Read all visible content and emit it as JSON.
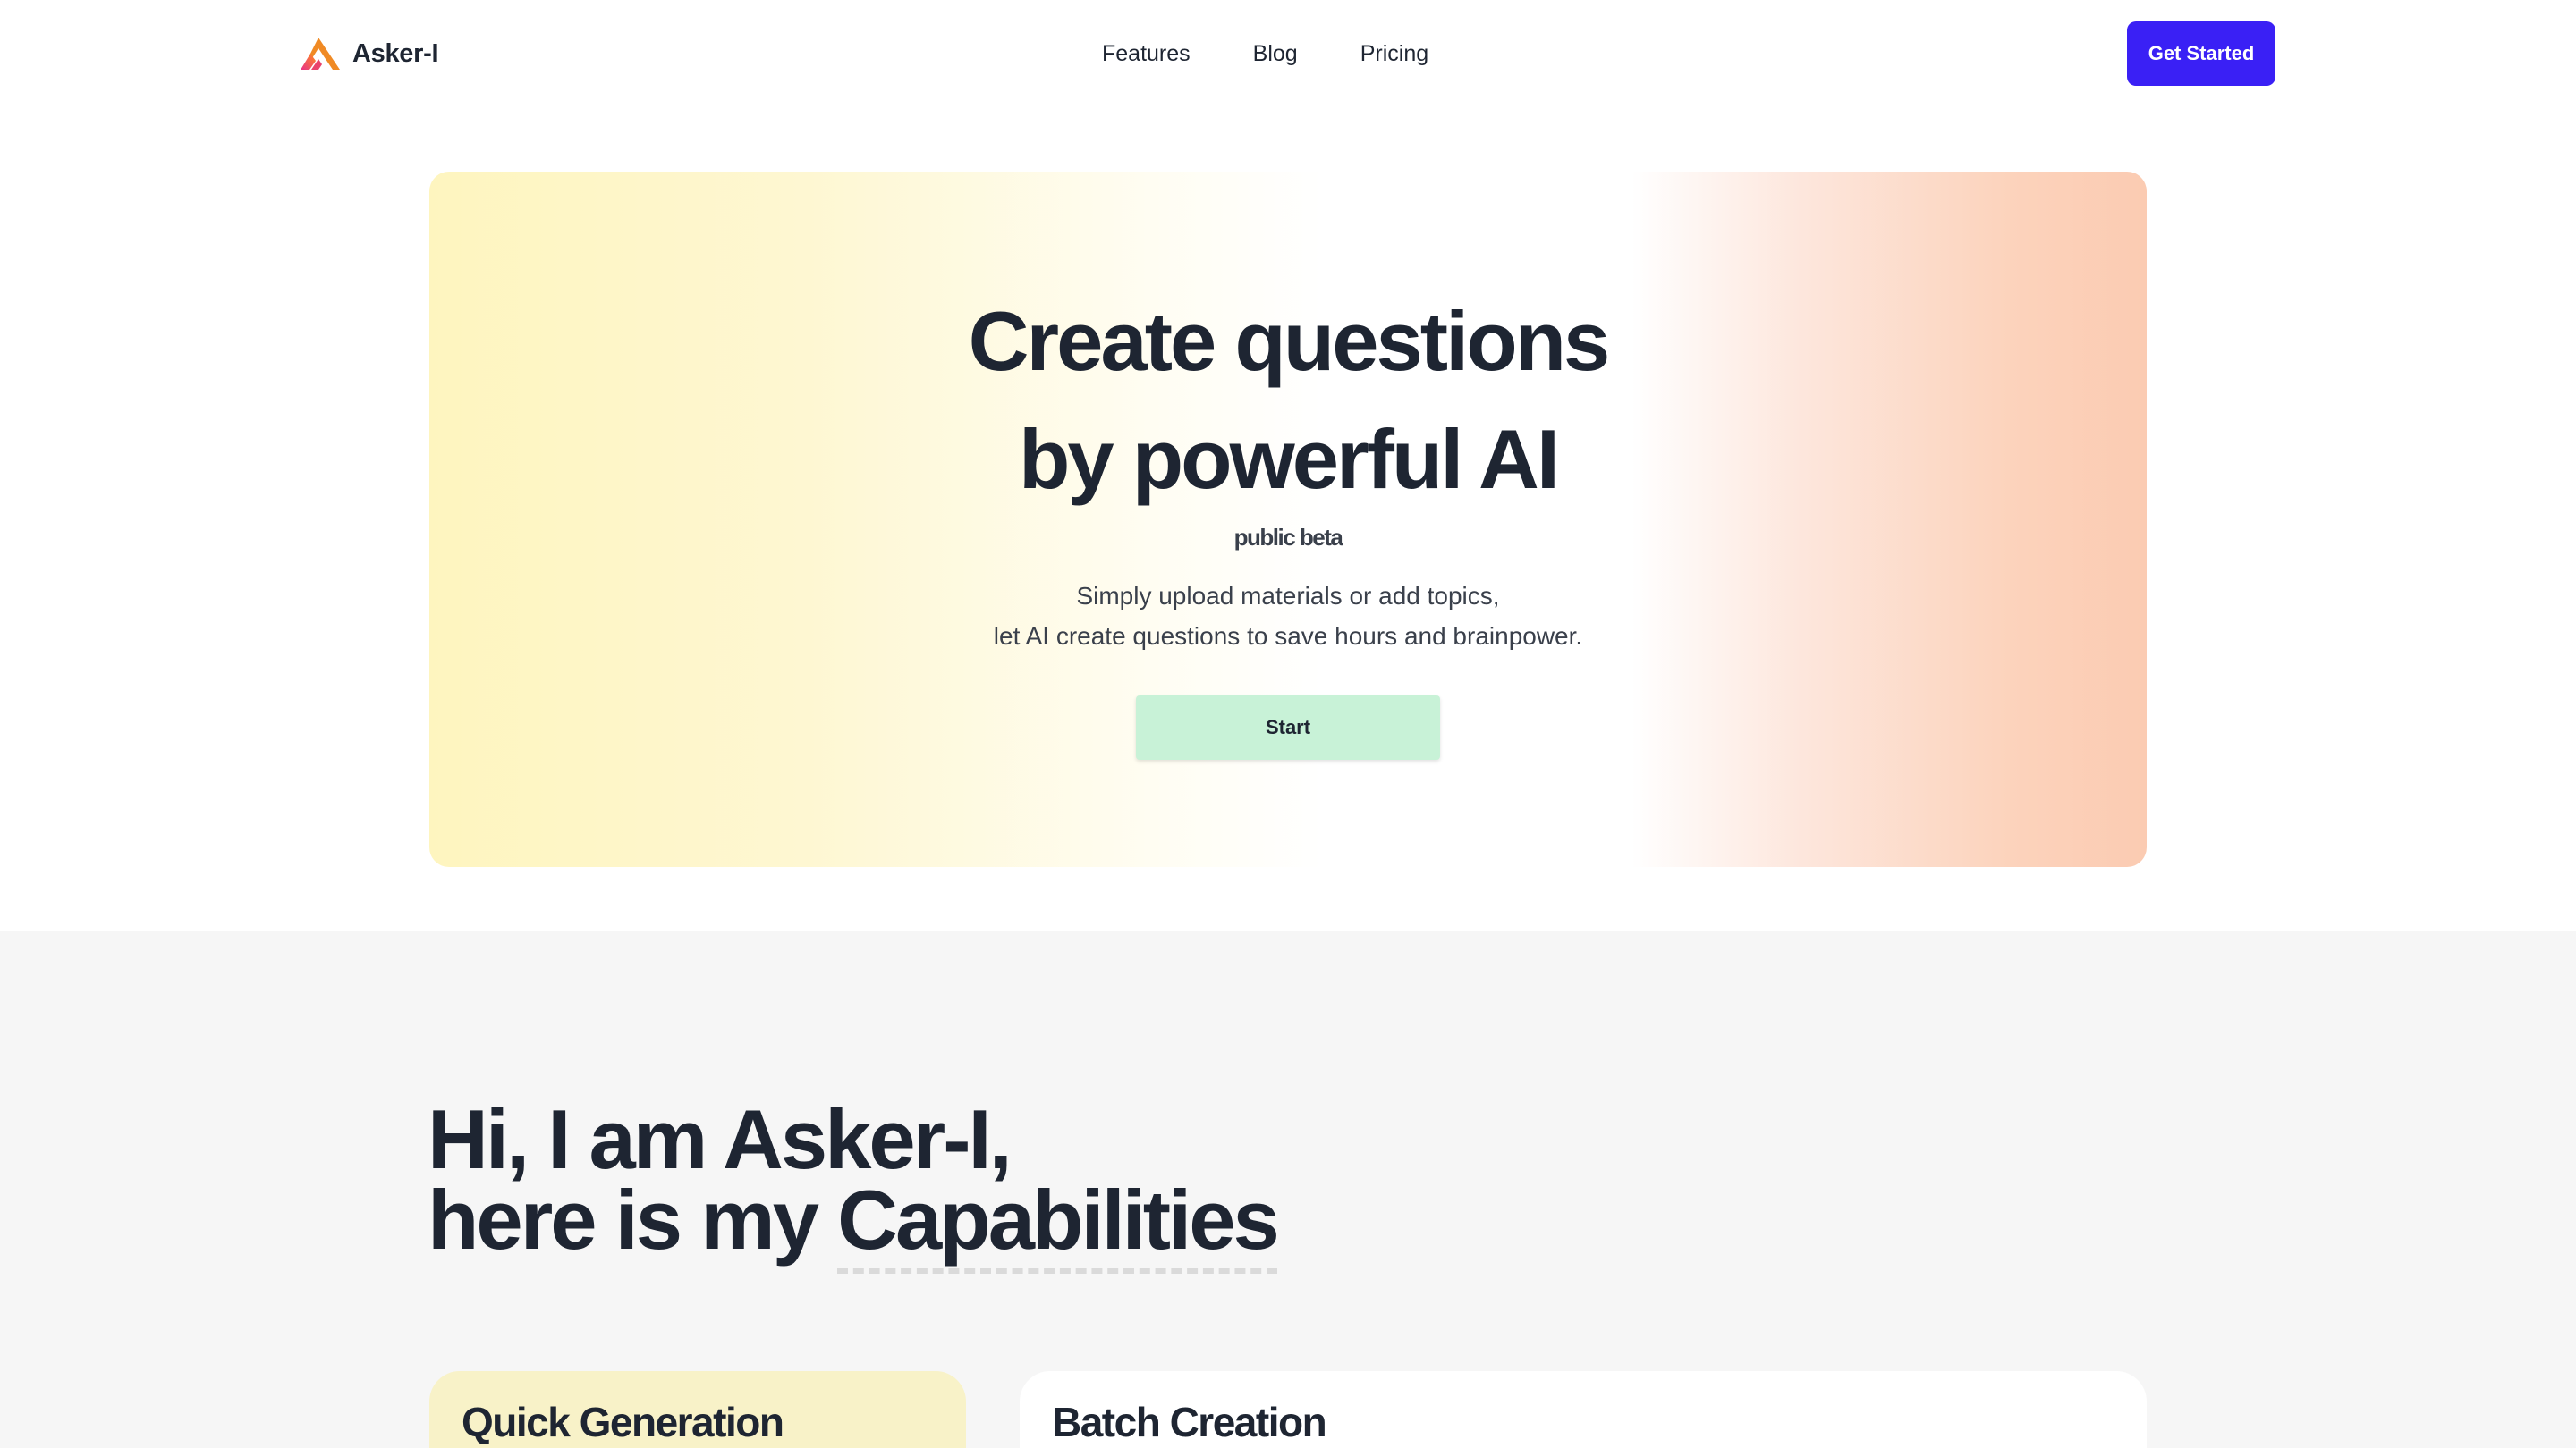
{
  "nav": {
    "logo_text": "Asker-I",
    "logo_icon": "triangle-logo-icon",
    "links": [
      "Features",
      "Blog",
      "Pricing"
    ],
    "cta_label": "Get Started"
  },
  "hero": {
    "title_line1": "Create questions",
    "title_line2": "by powerful AI",
    "badge": "public beta",
    "subtitle_line1": "Simply upload materials or add topics,",
    "subtitle_line2": "let AI create questions to save hours and brainpower.",
    "start_label": "Start"
  },
  "capabilities": {
    "heading_line1": "Hi, I am Asker-I,",
    "heading_line2_prefix": "here is my ",
    "heading_line2_highlight": "Capabilities",
    "cards": [
      {
        "title": "Quick Generation"
      },
      {
        "title": "Batch Creation"
      }
    ]
  },
  "colors": {
    "brand_blue": "#3a20f5",
    "start_green": "#c8f2d7",
    "text_dark": "#1e2532",
    "hero_yellow": "#fef5bf",
    "hero_peach": "#fbcbb2",
    "section_gray": "#f6f6f6"
  }
}
